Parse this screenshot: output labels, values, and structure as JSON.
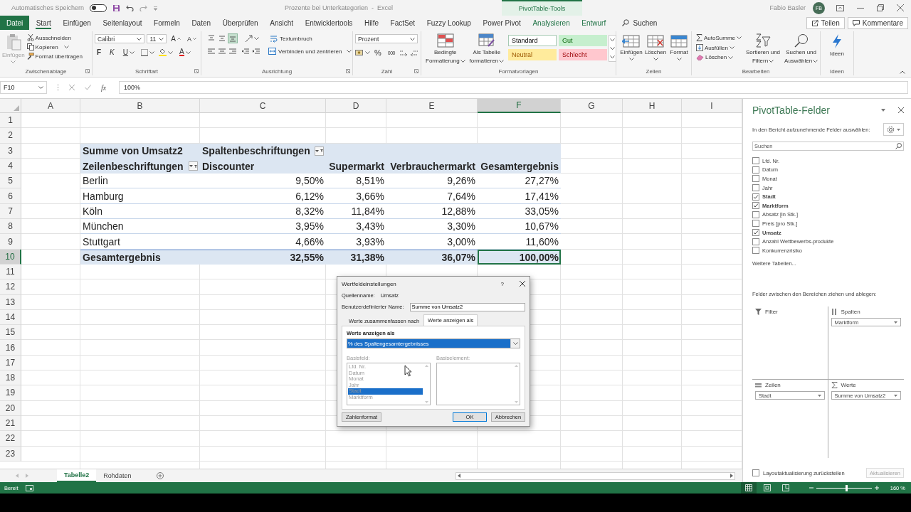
{
  "title_bar": {
    "autosave_label": "Automatisches Speichern",
    "autosave_on": false,
    "document_title": "Prozente bei Unterkategorien  -  Excel",
    "context_tab": "PivotTable-Tools",
    "user_name": "Fabio Basler",
    "user_initials": "FB"
  },
  "menu_tabs": [
    {
      "label": "Datei",
      "kind": "file",
      "selected": false
    },
    {
      "label": "Start",
      "kind": "tab",
      "selected": true
    },
    {
      "label": "Einfügen",
      "kind": "tab",
      "selected": false
    },
    {
      "label": "Seitenlayout",
      "kind": "tab",
      "selected": false
    },
    {
      "label": "Formeln",
      "kind": "tab",
      "selected": false
    },
    {
      "label": "Daten",
      "kind": "tab",
      "selected": false
    },
    {
      "label": "Überprüfen",
      "kind": "tab",
      "selected": false
    },
    {
      "label": "Ansicht",
      "kind": "tab",
      "selected": false
    },
    {
      "label": "Entwicklertools",
      "kind": "tab",
      "selected": false
    },
    {
      "label": "Hilfe",
      "kind": "tab",
      "selected": false
    },
    {
      "label": "FactSet",
      "kind": "tab",
      "selected": false
    },
    {
      "label": "Fuzzy Lookup",
      "kind": "tab",
      "selected": false
    },
    {
      "label": "Power Pivot",
      "kind": "tab",
      "selected": false
    },
    {
      "label": "Analysieren",
      "kind": "context",
      "selected": false
    },
    {
      "label": "Entwurf",
      "kind": "context",
      "selected": false
    }
  ],
  "tell_me": "Suchen",
  "share_button": "Teilen",
  "comments_button": "Kommentare",
  "ribbon": {
    "clipboard": {
      "label": "Zwischenablage",
      "paste": "Einfügen",
      "paste_disabled": true,
      "cut": "Ausschneiden",
      "copy": "Kopieren",
      "format_painter": "Format übertragen"
    },
    "font": {
      "label": "Schriftart",
      "family": "Calibri",
      "size": "11",
      "grow": "A",
      "shrink": "A",
      "bold": "F",
      "italic": "K",
      "underline": "U",
      "font_color": "A"
    },
    "alignment": {
      "label": "Ausrichtung",
      "wrap": "Textumbruch",
      "merge": "Verbinden und zentrieren",
      "vertical": [
        {
          "selected": false
        },
        {
          "selected": false
        },
        {
          "selected": true
        }
      ]
    },
    "number": {
      "label": "Zahl",
      "format": "Prozent",
      "percent": "%",
      "thousands": "000"
    },
    "styles": {
      "label": "Formatvorlagen",
      "conditional": [
        "Bedingte",
        "Formatierung"
      ],
      "as_table": [
        "Als Tabelle",
        "formatieren"
      ],
      "cell_styles": [
        {
          "label": "Standard",
          "kind": "normal"
        },
        {
          "label": "Gut",
          "kind": "good"
        },
        {
          "label": "Neutral",
          "kind": "neutral"
        },
        {
          "label": "Schlecht",
          "kind": "bad"
        }
      ]
    },
    "cells": {
      "label": "Zellen",
      "buttons": [
        {
          "label": "Einfügen",
          "kind": "insert"
        },
        {
          "label": "Löschen",
          "kind": "delete"
        },
        {
          "label": "Format",
          "kind": "format"
        }
      ]
    },
    "editing": {
      "label": "Bearbeiten",
      "autosum": "AutoSumme",
      "fill": "Ausfüllen",
      "clear": "Löschen",
      "sort": [
        "Sortieren und",
        "Filtern"
      ],
      "find": [
        "Suchen und",
        "Auswählen"
      ]
    },
    "ideas": {
      "label": "Ideen",
      "button": "Ideen"
    }
  },
  "formula_bar": {
    "name_box": "F10",
    "fx": "fx",
    "value": "100%"
  },
  "grid": {
    "columns": [
      {
        "label": "A",
        "selected": false
      },
      {
        "label": "B",
        "selected": false
      },
      {
        "label": "C",
        "selected": false
      },
      {
        "label": "D",
        "selected": false
      },
      {
        "label": "E",
        "selected": false
      },
      {
        "label": "F",
        "selected": true
      },
      {
        "label": "G",
        "selected": false
      },
      {
        "label": "H",
        "selected": false
      },
      {
        "label": "I",
        "selected": false
      }
    ],
    "rows": [
      {
        "number": "1",
        "selected": false
      },
      {
        "number": "2",
        "selected": false
      },
      {
        "number": "3",
        "selected": false,
        "kind": "title",
        "cells": [
          "Summe von Umsatz2",
          "Spaltenbeschriftungen"
        ]
      },
      {
        "number": "4",
        "selected": false,
        "kind": "header",
        "cells": [
          "Zeilenbeschriftungen",
          "Discounter",
          "Supermarkt",
          "Verbrauchermarkt",
          "Gesamtergebnis"
        ]
      },
      {
        "number": "5",
        "selected": false,
        "kind": "data",
        "cells": [
          "Berlin",
          "9,50%",
          "8,51%",
          "9,26%",
          "27,27%"
        ]
      },
      {
        "number": "6",
        "selected": false,
        "kind": "data",
        "cells": [
          "Hamburg",
          "6,12%",
          "3,66%",
          "7,64%",
          "17,41%"
        ]
      },
      {
        "number": "7",
        "selected": false,
        "kind": "data",
        "cells": [
          "Köln",
          "8,32%",
          "11,84%",
          "12,88%",
          "33,05%"
        ]
      },
      {
        "number": "8",
        "selected": false,
        "kind": "data",
        "cells": [
          "München",
          "3,95%",
          "3,43%",
          "3,30%",
          "10,67%"
        ]
      },
      {
        "number": "9",
        "selected": false,
        "kind": "data",
        "cells": [
          "Stuttgart",
          "4,66%",
          "3,93%",
          "3,00%",
          "11,60%"
        ]
      },
      {
        "number": "10",
        "selected": true,
        "kind": "total",
        "cells": [
          "Gesamtergebnis",
          "32,55%",
          "31,38%",
          "36,07%",
          "100,00%"
        ]
      },
      {
        "number": "11",
        "selected": false
      },
      {
        "number": "12",
        "selected": false
      },
      {
        "number": "13",
        "selected": false
      },
      {
        "number": "14",
        "selected": false
      },
      {
        "number": "15",
        "selected": false
      },
      {
        "number": "16",
        "selected": false
      },
      {
        "number": "17",
        "selected": false
      },
      {
        "number": "18",
        "selected": false
      },
      {
        "number": "19",
        "selected": false
      },
      {
        "number": "20",
        "selected": false
      },
      {
        "number": "21",
        "selected": false
      },
      {
        "number": "22",
        "selected": false
      },
      {
        "number": "23",
        "selected": false
      }
    ]
  },
  "sheet_tabs": [
    {
      "label": "Tabelle2",
      "selected": true
    },
    {
      "label": "Rohdaten",
      "selected": false
    }
  ],
  "status_bar": {
    "ready": "Bereit",
    "views": [
      {
        "kind": "normal",
        "selected": true
      },
      {
        "kind": "page_layout",
        "selected": false
      },
      {
        "kind": "page_break",
        "selected": false
      }
    ],
    "zoom_slider": {
      "level": 0.55
    },
    "zoom": "160 %"
  },
  "pivot_pane": {
    "title": "PivotTable-Felder",
    "prompt": "In den Bericht aufzunehmende Felder auswählen:",
    "search_placeholder": "Suchen",
    "fields": [
      {
        "label": "Lfd. Nr.",
        "checked": false
      },
      {
        "label": "Datum",
        "checked": false
      },
      {
        "label": "Monat",
        "checked": false
      },
      {
        "label": "Jahr",
        "checked": false
      },
      {
        "label": "Stadt",
        "checked": true
      },
      {
        "label": "Marktform",
        "checked": true
      },
      {
        "label": "Absatz [in Stk.]",
        "checked": false
      },
      {
        "label": "Preis [pro Stk.]",
        "checked": false
      },
      {
        "label": "Umsatz",
        "checked": true
      },
      {
        "label": "Anzahl Wettbewerbs-produkte",
        "checked": false
      },
      {
        "label": "Konkurrenzrisiko",
        "checked": false
      }
    ],
    "more_tables": "Weitere Tabellen...",
    "areas_prompt": "Felder zwischen den Bereichen ziehen und ablegen:",
    "areas": [
      {
        "kind": "filter",
        "label": "Filter"
      },
      {
        "kind": "columns",
        "label": "Spalten",
        "items": [
          "Marktform"
        ]
      },
      {
        "kind": "rows",
        "label": "Zeilen",
        "items": [
          "Stadt"
        ]
      },
      {
        "kind": "values",
        "label": "Werte",
        "items": [
          "Summe von Umsatz2"
        ]
      }
    ],
    "defer_label": "Layoutaktualisierung zurückstellen",
    "defer_checked": false,
    "update_button": "Aktualisieren",
    "update_disabled": true
  },
  "dialog": {
    "title": "Wertfeldeinstellungen",
    "help": "?",
    "source_label": "Quellenname:",
    "source_value": "Umsatz",
    "name_label": "Benutzerdefinierter Name:",
    "name_value": "Summe von Umsatz2",
    "tabs": [
      {
        "label": "Werte zusammenfassen nach",
        "selected": false
      },
      {
        "label": "Werte anzeigen als",
        "selected": true
      }
    ],
    "show_as_label": "Werte anzeigen als",
    "show_as_value": "% des Spaltengesamtergebnisses",
    "lists_disabled": true,
    "base_field_label": "Basisfeld:",
    "base_item_label": "Basiselement:",
    "base_fields": [
      {
        "label": "Lfd. Nr.",
        "selected": false
      },
      {
        "label": "Datum",
        "selected": false
      },
      {
        "label": "Monat",
        "selected": false
      },
      {
        "label": "Jahr",
        "selected": false
      },
      {
        "label": "Stadt",
        "selected": true
      },
      {
        "label": "Marktform",
        "selected": false
      }
    ],
    "number_format_button": "Zahlenformat",
    "ok_button": "OK",
    "cancel_button": "Abbrechen"
  }
}
